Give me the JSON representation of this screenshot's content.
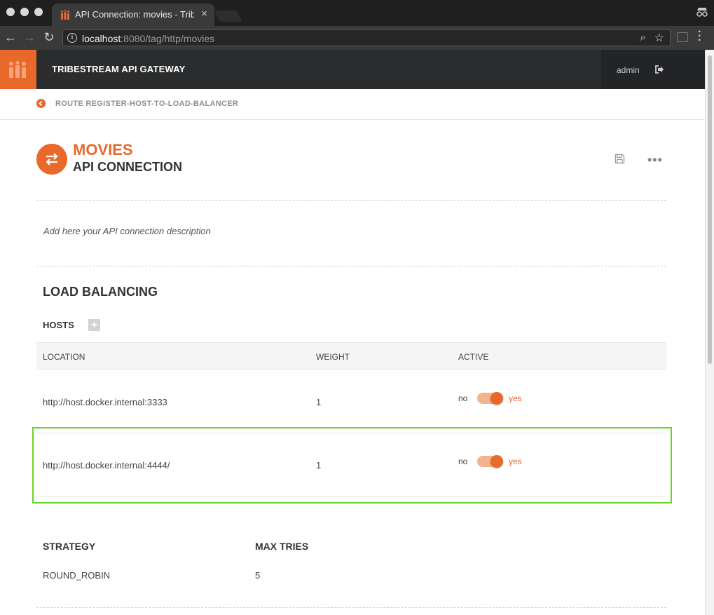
{
  "browser": {
    "tab_title": "API Connection: movies - Tribe",
    "tab_close": "×",
    "url_host": "localhost",
    "url_rest": ":8080/tag/http/movies"
  },
  "header": {
    "app_title": "TRIBESTREAM API GATEWAY",
    "user": "admin"
  },
  "breadcrumb": {
    "label": "ROUTE REGISTER-HOST-TO-LOAD-BALANCER"
  },
  "page": {
    "title": "MOVIES",
    "subtitle": "API CONNECTION",
    "description": "Add here your API connection description",
    "more_label": "•••"
  },
  "load_balancing": {
    "title": "LOAD BALANCING",
    "hosts_label": "HOSTS",
    "add_label": "+",
    "columns": [
      "LOCATION",
      "WEIGHT",
      "ACTIVE"
    ],
    "rows": [
      {
        "location": "http://host.docker.internal:3333",
        "weight": "1",
        "no": "no",
        "yes": "yes",
        "active": true
      },
      {
        "location": "http://host.docker.internal:4444/",
        "weight": "1",
        "no": "no",
        "yes": "yes",
        "active": true
      }
    ],
    "strategy_label": "STRATEGY",
    "strategy_value": "ROUND_ROBIN",
    "max_tries_label": "MAX TRIES",
    "max_tries_value": "5"
  },
  "colors": {
    "accent": "#e8692a",
    "header_bg": "#2b2c2e",
    "highlight": "#69d327"
  }
}
